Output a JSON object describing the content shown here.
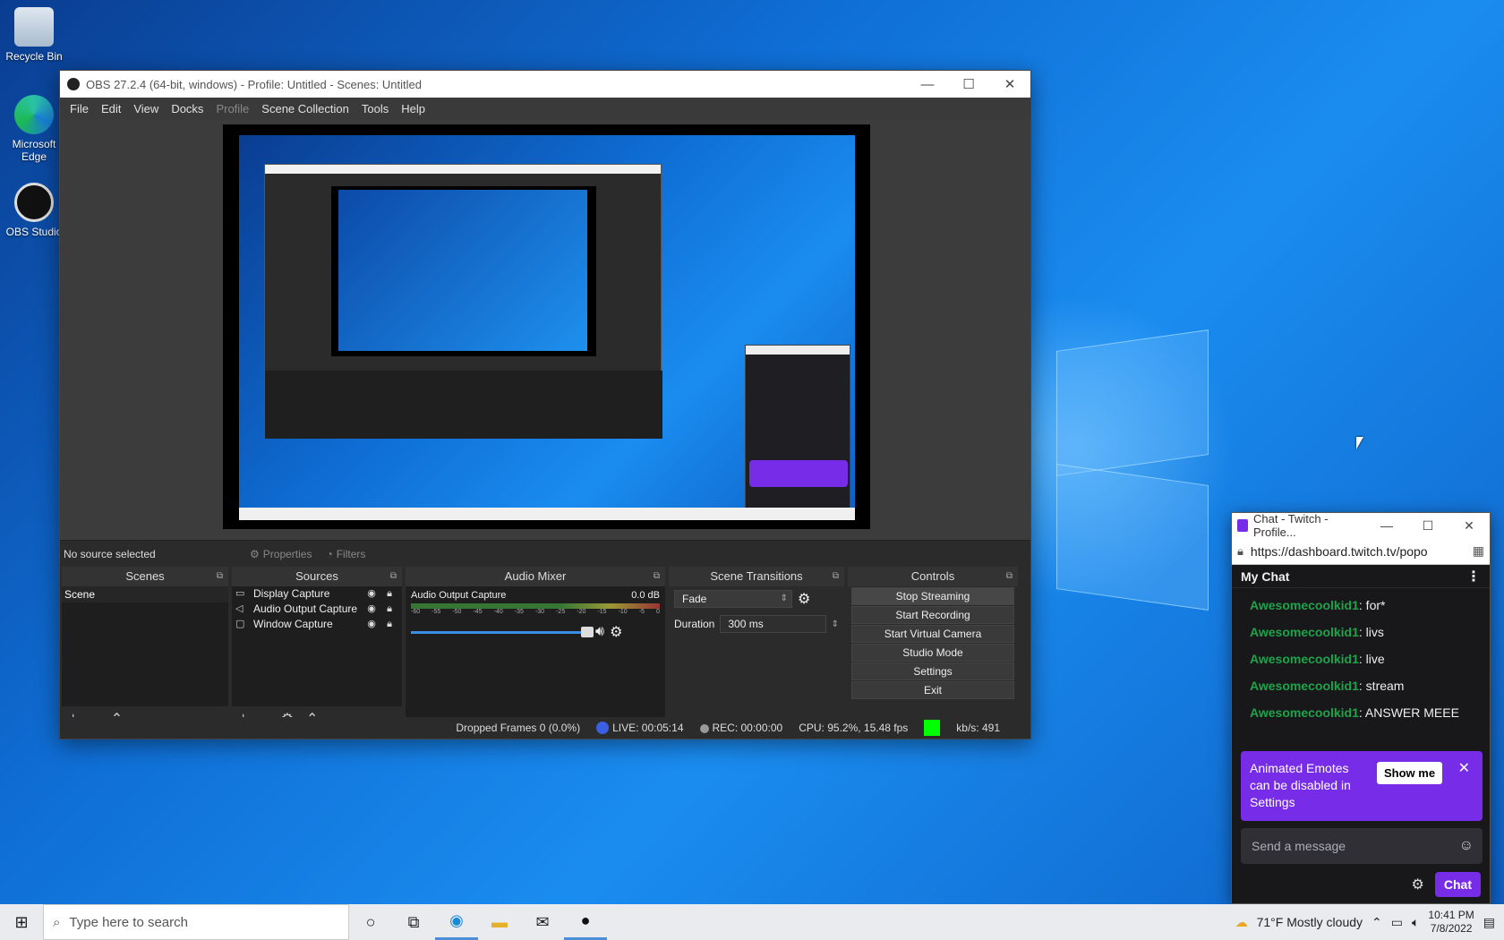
{
  "desktop": {
    "icons": [
      {
        "label": "Recycle Bin"
      },
      {
        "label": "Microsoft Edge"
      },
      {
        "label": "OBS Studio"
      }
    ]
  },
  "obs": {
    "title": "OBS 27.2.4 (64-bit, windows) - Profile: Untitled - Scenes: Untitled",
    "menu": [
      "File",
      "Edit",
      "View",
      "Docks",
      "Profile",
      "Scene Collection",
      "Tools",
      "Help"
    ],
    "source_bar": {
      "status": "No source selected",
      "properties": "Properties",
      "filters": "Filters"
    },
    "docks": {
      "scenes": {
        "title": "Scenes",
        "items": [
          "Scene"
        ]
      },
      "sources": {
        "title": "Sources",
        "items": [
          {
            "name": "Display Capture",
            "icon": "monitor-icon"
          },
          {
            "name": "Audio Output Capture",
            "icon": "speaker-icon"
          },
          {
            "name": "Window Capture",
            "icon": "window-icon"
          }
        ]
      },
      "mixer": {
        "title": "Audio Mixer",
        "channel": "Audio Output Capture",
        "level": "0.0 dB",
        "ticks": [
          "-60",
          "-55",
          "-50",
          "-45",
          "-40",
          "-35",
          "-30",
          "-25",
          "-20",
          "-15",
          "-10",
          "-5",
          "0"
        ],
        "volume": 1.0
      },
      "transitions": {
        "title": "Scene Transitions",
        "selected": "Fade",
        "duration_label": "Duration",
        "duration": "300 ms"
      },
      "controls": {
        "title": "Controls",
        "buttons": [
          "Stop Streaming",
          "Start Recording",
          "Start Virtual Camera",
          "Studio Mode",
          "Settings",
          "Exit"
        ]
      }
    },
    "status": {
      "dropped": "Dropped Frames 0 (0.0%)",
      "live": "LIVE: 00:05:14",
      "rec": "REC: 00:00:00",
      "cpu": "CPU: 95.2%, 15.48 fps",
      "kbs": "kb/s: 491",
      "status_color": "#00ff00"
    }
  },
  "chat": {
    "title": "Chat - Twitch - Profile...",
    "url": "https://dashboard.twitch.tv/popo",
    "header": "My Chat",
    "messages": [
      {
        "user": "Awesomecoolkid1",
        "text": ": for*"
      },
      {
        "user": "Awesomecoolkid1",
        "text": ": livs"
      },
      {
        "user": "Awesomecoolkid1",
        "text": ": live"
      },
      {
        "user": "Awesomecoolkid1",
        "text": ": stream"
      },
      {
        "user": "Awesomecoolkid1",
        "text": ": ANSWER MEEE"
      }
    ],
    "banner": {
      "text": "Animated Emotes can be disabled in Settings",
      "show_me": "Show me"
    },
    "input_placeholder": "Send a message",
    "chat_button": "Chat",
    "accent": "#772ce8",
    "username_color": "#1fa34a"
  },
  "taskbar": {
    "search_placeholder": "Type here to search",
    "weather": "71°F  Mostly cloudy",
    "time": "10:41 PM",
    "date": "7/8/2022"
  }
}
